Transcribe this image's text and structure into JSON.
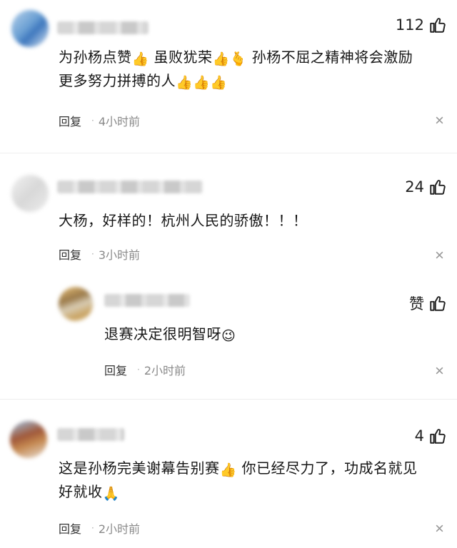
{
  "comments": [
    {
      "likes": "112",
      "line1": "为孙杨点赞",
      "e1": "👍",
      "line1b": "虽败犹荣",
      "e2": "👍🫰",
      "line1c": "孙杨不屈之精神将会激励",
      "line2": "更多努力拼搏的人",
      "e3": "👍👍👍",
      "reply": "回复",
      "time": "4小时前"
    },
    {
      "likes": "24",
      "text": "大杨，好样的！杭州人民的骄傲！！！",
      "reply": "回复",
      "time": "3小时前",
      "sub": {
        "likes": "赞",
        "text": "退赛决定很明智呀",
        "emoji": "😉",
        "reply": "回复",
        "time": "2小时前"
      }
    },
    {
      "likes": "4",
      "line1": "这是孙杨完美谢幕告别赛",
      "e1": "👍",
      "line1b": "你已经尽力了，功成名就见",
      "line2": "好就收",
      "e2": "🙏",
      "reply": "回复",
      "time": "2小时前"
    }
  ],
  "icons": {
    "like": "thumbs-up-icon",
    "close": "close-icon"
  }
}
